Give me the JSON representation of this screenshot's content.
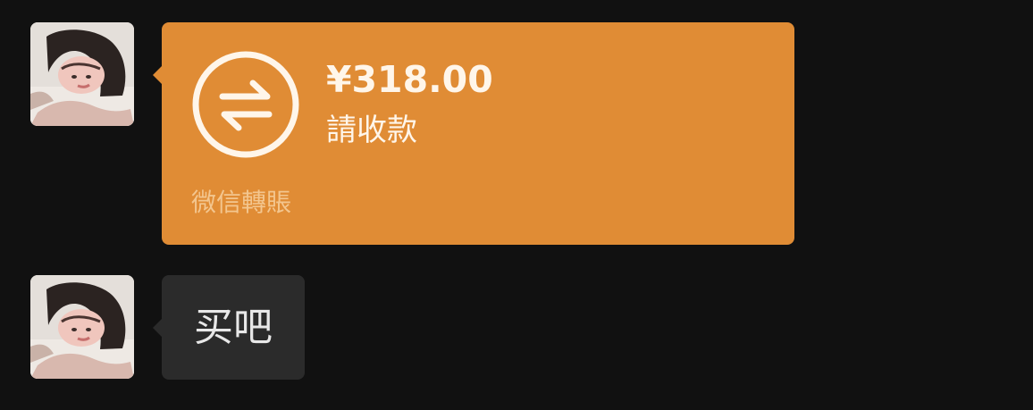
{
  "colors": {
    "background": "#111111",
    "transfer_card": "#e08c35",
    "transfer_text": "#fff6ea",
    "transfer_service_text": "#f3c68f",
    "text_bubble": "#2b2b2b",
    "text_bubble_text": "#e8e8e8"
  },
  "messages": [
    {
      "type": "transfer",
      "avatar_icon": "user-avatar",
      "transfer_icon": "exchange-arrows-icon",
      "amount": "¥318.00",
      "status": "請收款",
      "service": "微信轉賬"
    },
    {
      "type": "text",
      "avatar_icon": "user-avatar",
      "text": "买吧"
    }
  ]
}
